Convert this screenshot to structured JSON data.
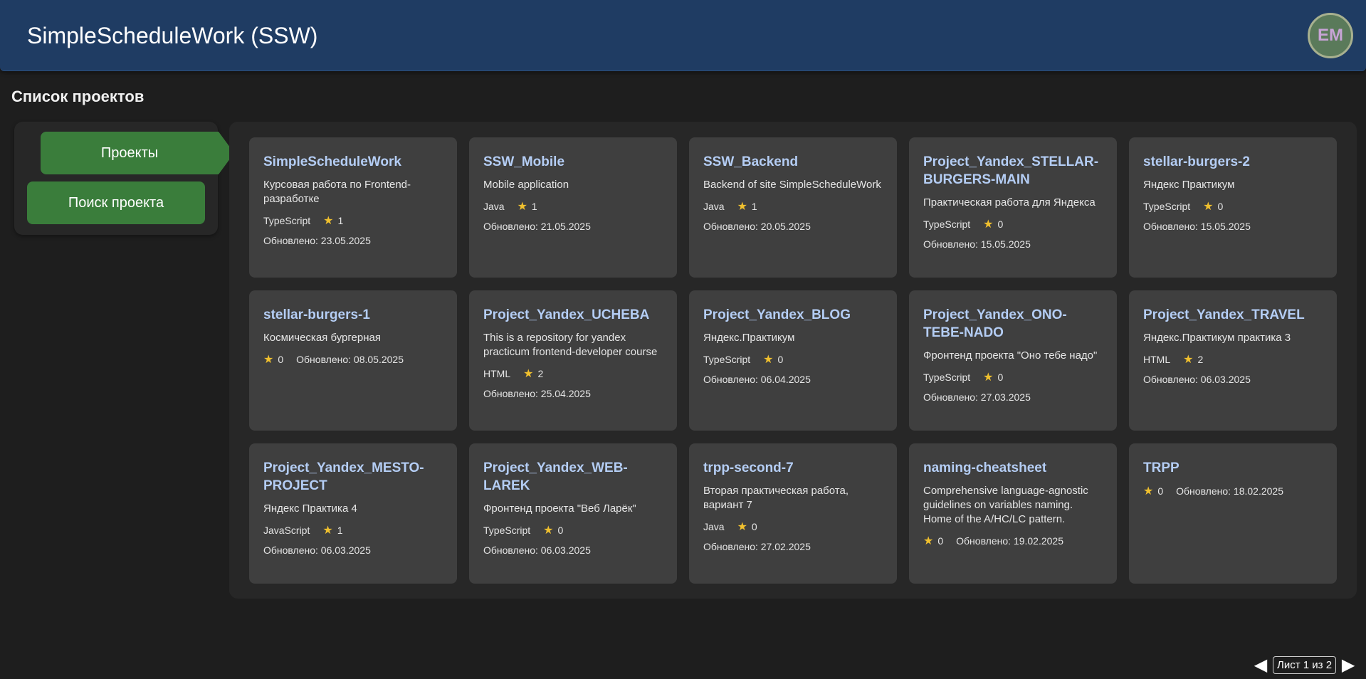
{
  "header": {
    "title": "SimpleScheduleWork (SSW)",
    "avatar_initials": "EM"
  },
  "page_title": "Список проектов",
  "sidebar": {
    "items": [
      {
        "label": "Проекты",
        "active": true
      },
      {
        "label": "Поиск проекта",
        "active": false
      }
    ]
  },
  "projects": [
    {
      "title": "SimpleScheduleWork",
      "description": "Курсовая работа по Frontend-разработке",
      "language": "TypeScript",
      "stars": "1",
      "updated": "Обновлено: 23.05.2025"
    },
    {
      "title": "SSW_Mobile",
      "description": "Mobile application",
      "language": "Java",
      "stars": "1",
      "updated": "Обновлено: 21.05.2025"
    },
    {
      "title": "SSW_Backend",
      "description": "Backend of site SimpleScheduleWork",
      "language": "Java",
      "stars": "1",
      "updated": "Обновлено: 20.05.2025"
    },
    {
      "title": "Project_Yandex_STELLAR-BURGERS-MAIN",
      "description": "Практическая работа для Яндекса",
      "language": "TypeScript",
      "stars": "0",
      "updated": "Обновлено: 15.05.2025"
    },
    {
      "title": "stellar-burgers-2",
      "description": "Яндекс Практикум",
      "language": "TypeScript",
      "stars": "0",
      "updated": "Обновлено: 15.05.2025"
    },
    {
      "title": "stellar-burgers-1",
      "description": "Космическая бургерная",
      "language": "",
      "stars": "0",
      "updated": "Обновлено: 08.05.2025"
    },
    {
      "title": "Project_Yandex_UCHEBA",
      "description": "This is a repository for yandex practicum frontend-developer course",
      "language": "HTML",
      "stars": "2",
      "updated": "Обновлено: 25.04.2025"
    },
    {
      "title": "Project_Yandex_BLOG",
      "description": "Яндекс.Практикум",
      "language": "TypeScript",
      "stars": "0",
      "updated": "Обновлено: 06.04.2025"
    },
    {
      "title": "Project_Yandex_ONO-TEBE-NADO",
      "description": "Фронтенд проекта \"Оно тебе надо\"",
      "language": "TypeScript",
      "stars": "0",
      "updated": "Обновлено: 27.03.2025"
    },
    {
      "title": "Project_Yandex_TRAVEL",
      "description": "Яндекс.Практикум практика 3",
      "language": "HTML",
      "stars": "2",
      "updated": "Обновлено: 06.03.2025"
    },
    {
      "title": "Project_Yandex_MESTO-PROJECT",
      "description": "Яндекс Практика 4",
      "language": "JavaScript",
      "stars": "1",
      "updated": "Обновлено: 06.03.2025"
    },
    {
      "title": "Project_Yandex_WEB-LAREK",
      "description": "Фронтенд проекта \"Веб Ларёк\"",
      "language": "TypeScript",
      "stars": "0",
      "updated": "Обновлено: 06.03.2025"
    },
    {
      "title": "trpp-second-7",
      "description": "Вторая практическая работа, вариант 7",
      "language": "Java",
      "stars": "0",
      "updated": "Обновлено: 27.02.2025"
    },
    {
      "title": "naming-cheatsheet",
      "description": "Comprehensive language-agnostic guidelines on variables naming. Home of the A/HC/LC pattern.",
      "language": "",
      "stars": "0",
      "updated": "Обновлено: 19.02.2025"
    },
    {
      "title": "TRPP",
      "description": "",
      "language": "",
      "stars": "0",
      "updated": "Обновлено: 18.02.2025"
    }
  ],
  "pagination": {
    "label": "Лист 1 из 2",
    "prev_icon": "triangle-left",
    "next_icon": "triangle-right"
  }
}
